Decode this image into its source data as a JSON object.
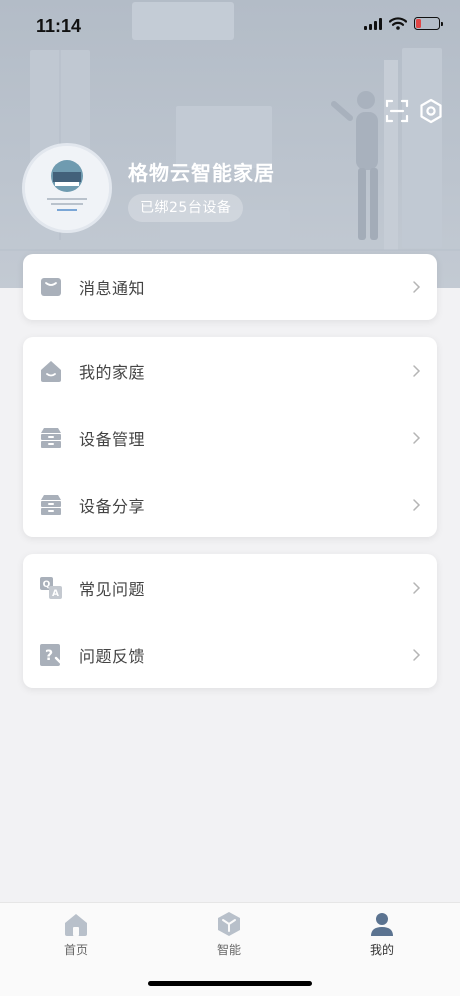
{
  "status_bar": {
    "time": "11:14"
  },
  "profile": {
    "home_name": "格物云智能家居",
    "bound_devices": "已绑25台设备"
  },
  "menu": {
    "messages": {
      "label": "消息通知"
    },
    "my_home": {
      "label": "我的家庭"
    },
    "device_management": {
      "label": "设备管理"
    },
    "device_sharing": {
      "label": "设备分享"
    },
    "faq": {
      "label": "常见问题"
    },
    "feedback": {
      "label": "问题反馈"
    }
  },
  "tabbar": {
    "tabs": [
      {
        "label": "首页",
        "active": false
      },
      {
        "label": "智能",
        "active": false
      },
      {
        "label": "我的",
        "active": true
      }
    ]
  },
  "colors": {
    "hero_bg": "#b3bcc7",
    "icon_gray": "#a9b0ba",
    "tab_active": "#5b7390",
    "tab_inactive": "#b8c0ca",
    "battery_low": "#e04646"
  }
}
